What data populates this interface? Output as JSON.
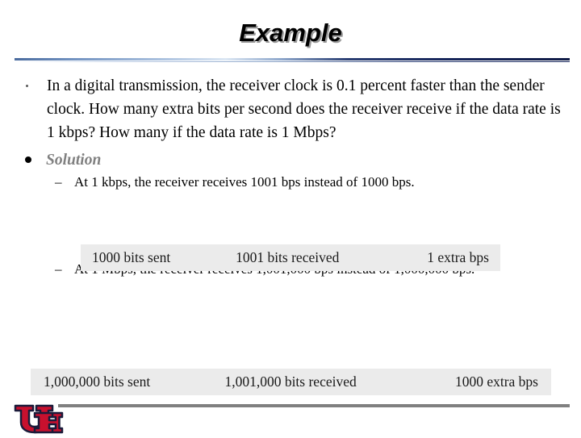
{
  "slide": {
    "title": "Example",
    "footer_logo_alt": "university-of-houston-logo"
  },
  "content": {
    "question_bullet": {
      "marker": "•",
      "text": "In a digital transmission, the receiver clock is 0.1 percent faster than the sender clock. How many extra bits per second does the receiver receive if the data rate is 1 kbps? How many if the data rate is 1 Mbps?"
    },
    "solution_heading": {
      "marker": "●",
      "label": "Solution"
    },
    "sub_points": [
      {
        "marker": "–",
        "text": "At 1 kbps, the receiver receives 1001 bps instead of 1000 bps."
      },
      {
        "marker": "–",
        "text": "At 1 Mbps, the receiver receives 1,001,000 bps instead of 1,000,000 bps."
      }
    ]
  },
  "figures": [
    {
      "sent": "1000 bits sent",
      "received": "1001 bits received",
      "extra": "1 extra bps"
    },
    {
      "sent": "1,000,000 bits sent",
      "received": "1,001,000 bits received",
      "extra": "1000 extra bps"
    }
  ],
  "colors": {
    "title_text": "#000000",
    "title_shadow": "#9a9a9a",
    "solution_text": "#808080",
    "figure_box_bg": "#ebebeb",
    "footer_rule": "#808080",
    "logo_red": "#c8102e",
    "logo_outline": "#1b1b3a",
    "divider_dark_blue": "#16255a",
    "divider_light_blue": "#dce7f3"
  }
}
